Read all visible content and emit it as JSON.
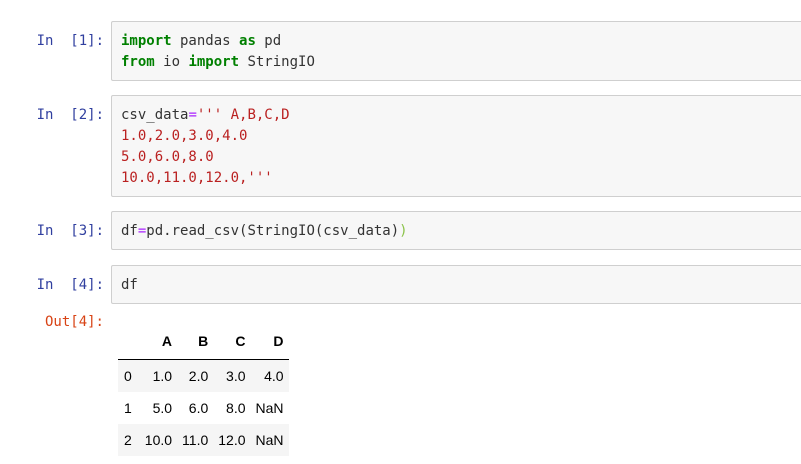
{
  "cells": [
    {
      "prompt": "In  [1]:",
      "lines": [
        [
          {
            "t": "import",
            "c": "kw"
          },
          {
            "t": " pandas ",
            "c": "plain"
          },
          {
            "t": "as",
            "c": "kw"
          },
          {
            "t": " pd",
            "c": "plain"
          }
        ],
        [
          {
            "t": "from",
            "c": "kw"
          },
          {
            "t": " io ",
            "c": "plain"
          },
          {
            "t": "import",
            "c": "kw"
          },
          {
            "t": " StringIO",
            "c": "plain"
          }
        ]
      ]
    },
    {
      "prompt": "In  [2]:",
      "lines": [
        [
          {
            "t": "csv_data",
            "c": "plain"
          },
          {
            "t": "=",
            "c": "op"
          },
          {
            "t": "''' A,B,C,D",
            "c": "str"
          }
        ],
        [
          {
            "t": "1.0,2.0,3.0,4.0",
            "c": "str"
          }
        ],
        [
          {
            "t": "5.0,6.0,8.0",
            "c": "str"
          }
        ],
        [
          {
            "t": "10.0,11.0,12.0,'''",
            "c": "str"
          }
        ]
      ]
    },
    {
      "prompt": "In  [3]:",
      "lines": [
        [
          {
            "t": "df",
            "c": "plain"
          },
          {
            "t": "=",
            "c": "op"
          },
          {
            "t": "pd.read_csv(StringIO(csv_data)",
            "c": "plain"
          },
          {
            "t": ")",
            "c": "paren-hi"
          }
        ]
      ]
    },
    {
      "prompt": "In  [4]:",
      "lines": [
        [
          {
            "t": "df",
            "c": "plain"
          }
        ]
      ]
    }
  ],
  "output": {
    "prompt": "Out[4]:",
    "table": {
      "columns": [
        "",
        "A",
        "B",
        "C",
        "D"
      ],
      "rows": [
        [
          "0",
          "1.0",
          "2.0",
          "3.0",
          "4.0"
        ],
        [
          "1",
          "5.0",
          "6.0",
          "8.0",
          "NaN"
        ],
        [
          "2",
          "10.0",
          "11.0",
          "12.0",
          "NaN"
        ]
      ]
    }
  }
}
